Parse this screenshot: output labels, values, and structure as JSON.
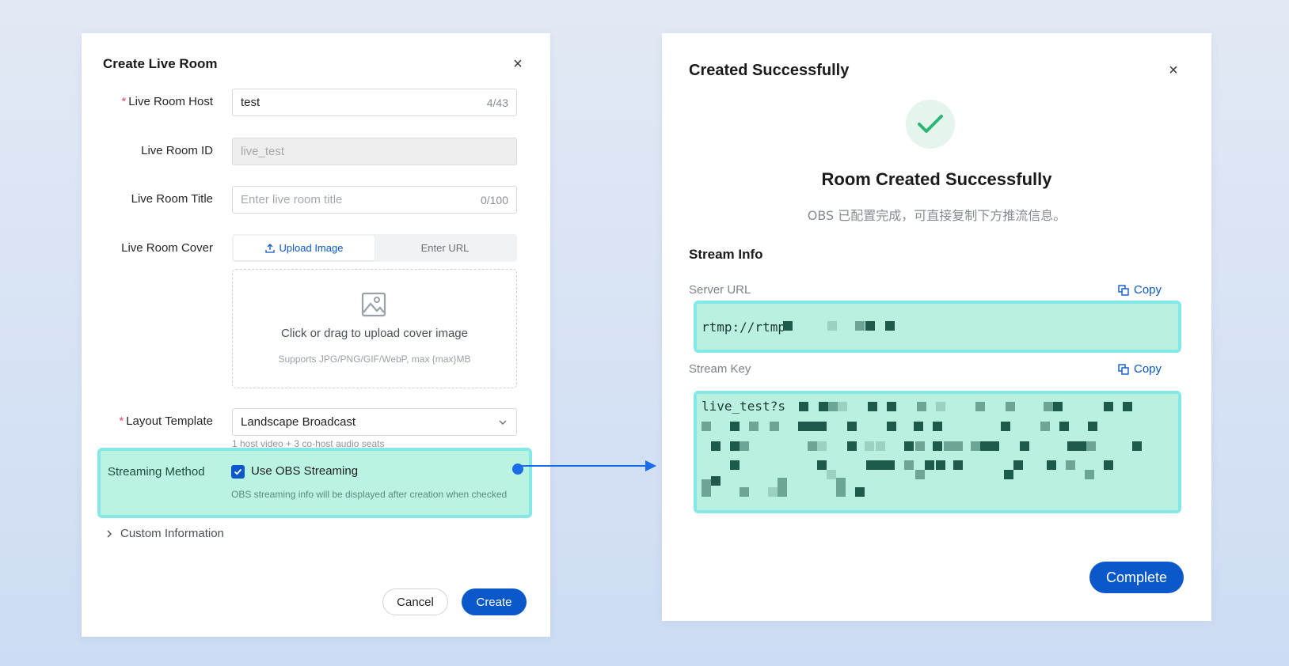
{
  "left_dialog": {
    "title": "Create Live Room",
    "host": {
      "label": "Live Room Host",
      "value": "test",
      "count": "4/43"
    },
    "room_id": {
      "label": "Live Room ID",
      "value": "live_test"
    },
    "room_title": {
      "label": "Live Room Title",
      "placeholder": "Enter live room title",
      "count": "0/100"
    },
    "cover": {
      "label": "Live Room Cover",
      "tabs": [
        "Upload Image",
        "Enter URL"
      ],
      "upload_main": "Click or drag to upload cover image",
      "upload_sub": "Supports JPG/PNG/GIF/WebP, max {max}MB"
    },
    "layout": {
      "label": "Layout Template",
      "value": "Landscape Broadcast",
      "hint": "1 host video + 3 co-host audio seats"
    },
    "streaming": {
      "label": "Streaming Method",
      "checkbox_label": "Use OBS Streaming",
      "checked": true,
      "description": "OBS streaming info will be displayed after creation when checked"
    },
    "custom_info": "Custom Information",
    "cancel": "Cancel",
    "create": "Create"
  },
  "right_dialog": {
    "title": "Created Successfully",
    "heading": "Room Created Successfully",
    "subtitle": "OBS 已配置完成，可直接复制下方推流信息。",
    "section": "Stream Info",
    "server_url": {
      "label": "Server URL",
      "copy": "Copy",
      "value": "rtmp://rtmp"
    },
    "stream_key": {
      "label": "Stream Key",
      "copy": "Copy",
      "value": "live_test?s"
    },
    "complete": "Complete"
  },
  "colors": {
    "primary": "#0a58ca",
    "highlight_fill": "#baf0e0",
    "highlight_border": "#86e8e6",
    "success": "#2bb673",
    "required": "#e34d59"
  }
}
